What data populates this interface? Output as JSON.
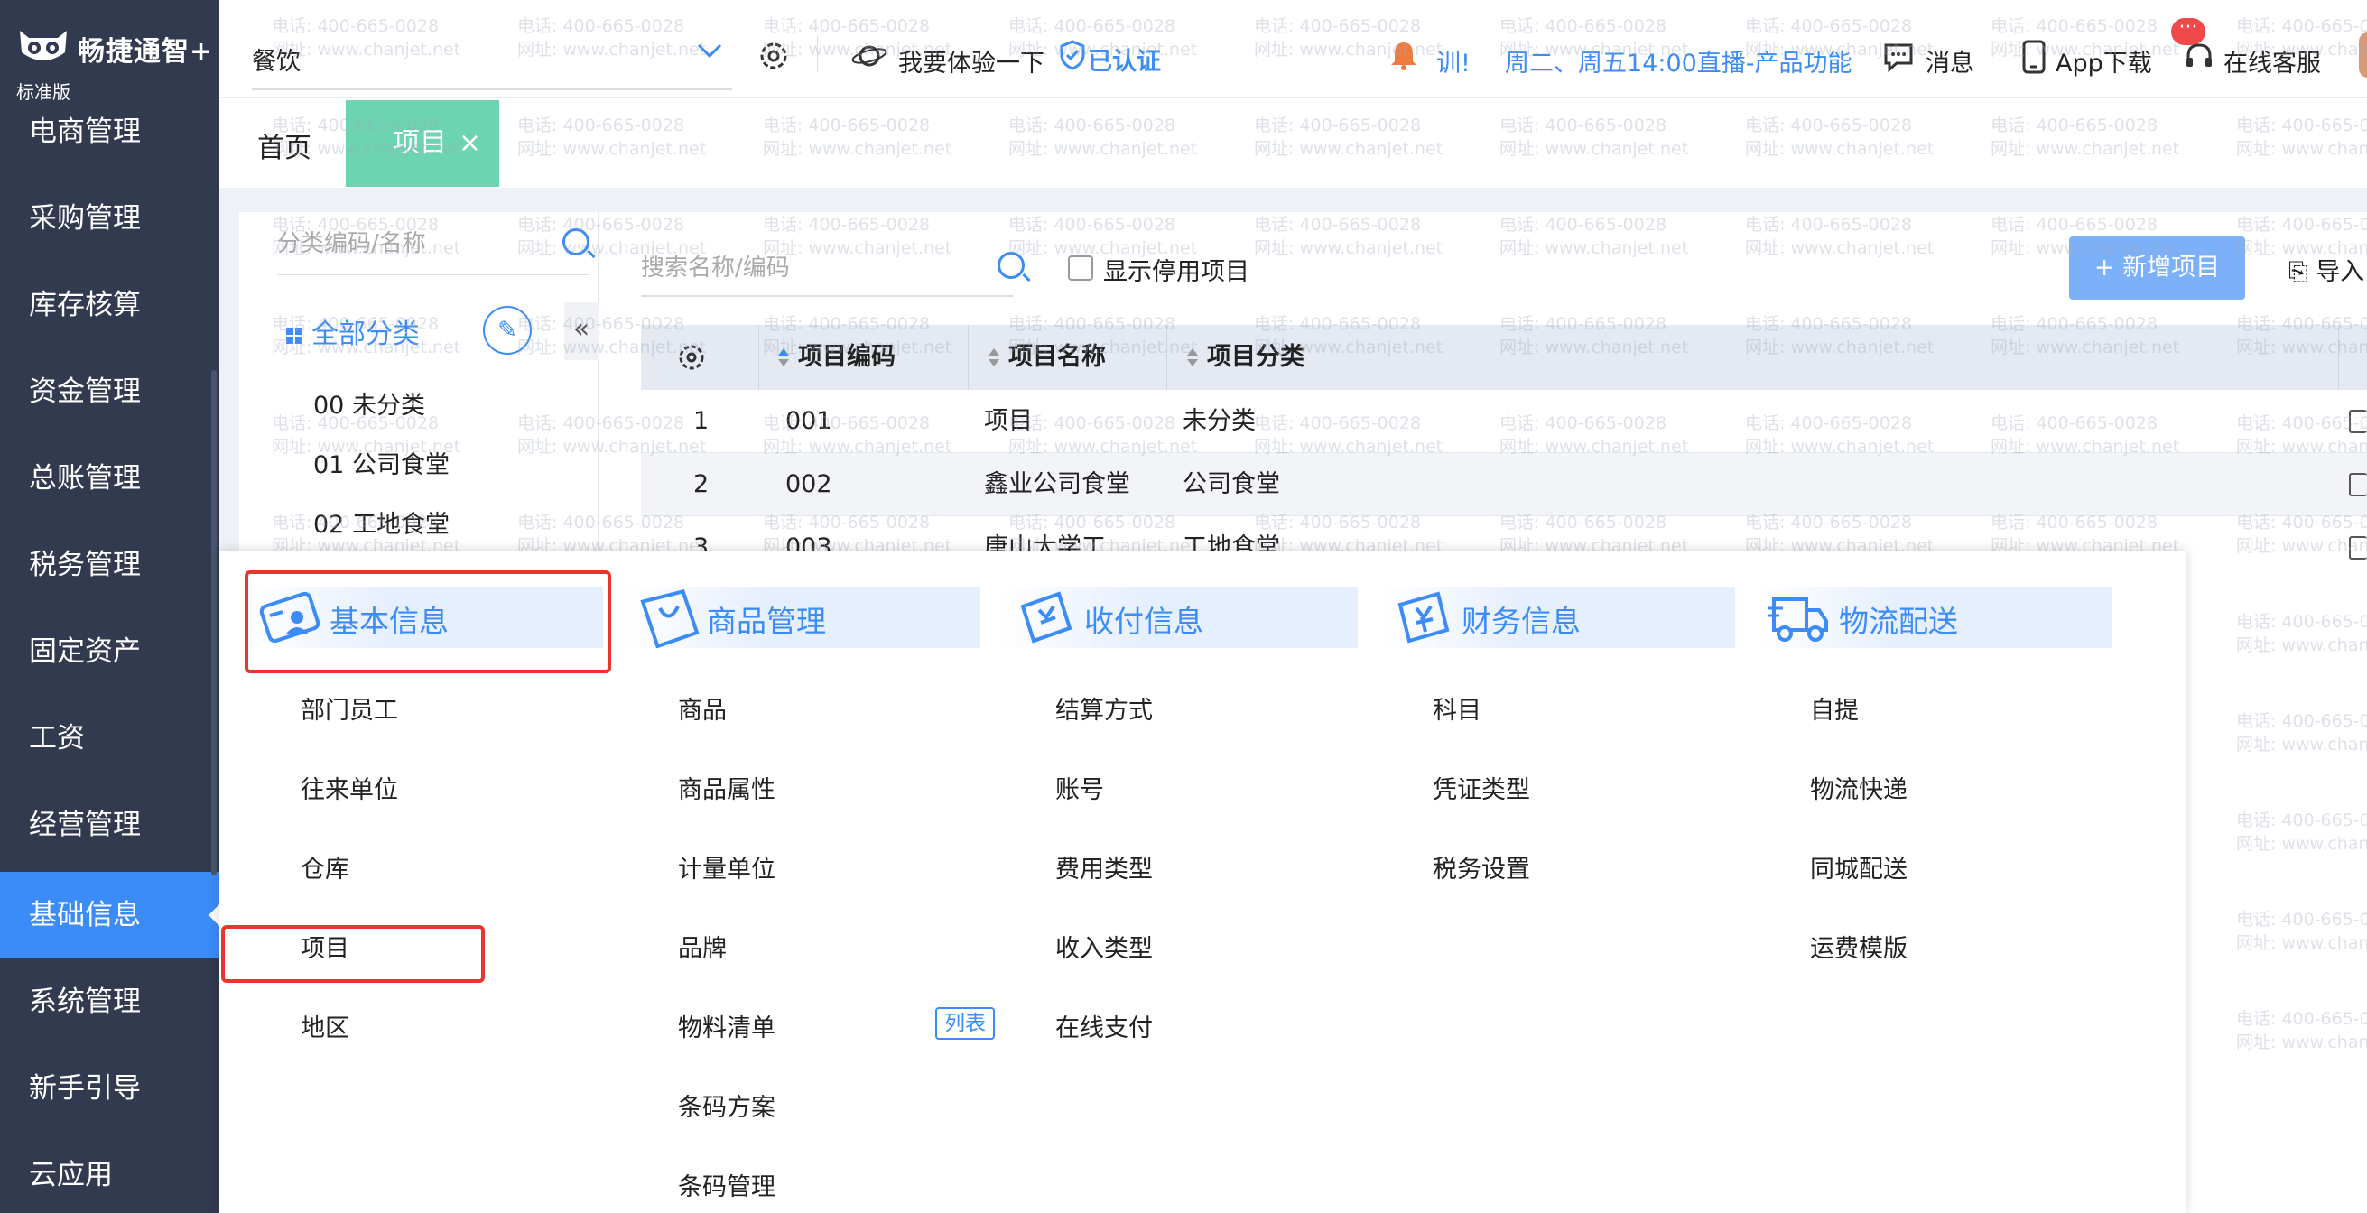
{
  "app": {
    "name": "畅捷通智+",
    "edition": "标准版"
  },
  "sidebar": {
    "items": [
      {
        "label": "电商管理"
      },
      {
        "label": "采购管理"
      },
      {
        "label": "库存核算"
      },
      {
        "label": "资金管理"
      },
      {
        "label": "总账管理"
      },
      {
        "label": "税务管理"
      },
      {
        "label": "固定资产"
      },
      {
        "label": "工资"
      },
      {
        "label": "经营管理"
      },
      {
        "label": "基础信息"
      },
      {
        "label": "系统管理"
      },
      {
        "label": "新手引导"
      },
      {
        "label": "云应用"
      }
    ],
    "active_index": 9
  },
  "topbar": {
    "industry": "餐饮",
    "experience": "我要体验一下",
    "verified": "已认证",
    "training": "训!",
    "live": "周二、周五14:00直播-产品功能",
    "messages": "消息",
    "message_badge": "···",
    "app_download": "App下载",
    "service": "在线客服"
  },
  "tabs": {
    "home": "首页",
    "active": "项目",
    "close": "×"
  },
  "category_panel": {
    "search_placeholder": "分类编码/名称",
    "all": "全部分类",
    "collapse": "«",
    "items": [
      "00 未分类",
      "01 公司食堂",
      "02 工地食堂"
    ]
  },
  "toolbar": {
    "search_placeholder": "搜索名称/编码",
    "show_disabled": "显示停用项目",
    "add": "+ 新增项目",
    "import": "导入"
  },
  "table": {
    "columns": [
      "项目编码",
      "项目名称",
      "项目分类"
    ],
    "rows": [
      {
        "no": "1",
        "code": "001",
        "name": "项目",
        "category": "未分类"
      },
      {
        "no": "2",
        "code": "002",
        "name": "鑫业公司食堂",
        "category": "公司食堂"
      },
      {
        "no": "3",
        "code": "003",
        "name": "唐山大学工",
        "category": "工地食堂"
      }
    ]
  },
  "watermark": {
    "line1": "电话: 400-665-0028",
    "line2": "网址: www.chanjet.net"
  },
  "menu": {
    "columns": [
      {
        "title": "基本信息",
        "icon": "id-card-icon",
        "items": [
          "部门员工",
          "往来单位",
          "仓库",
          "项目",
          "地区"
        ]
      },
      {
        "title": "商品管理",
        "icon": "shopping-bag-icon",
        "items": [
          "商品",
          "商品属性",
          "计量单位",
          "品牌",
          "物料清单",
          "条码方案",
          "条码管理"
        ]
      },
      {
        "title": "收付信息",
        "icon": "ticket-icon",
        "items": [
          "结算方式",
          "账号",
          "费用类型",
          "收入类型",
          "在线支付"
        ]
      },
      {
        "title": "财务信息",
        "icon": "finance-voucher-icon",
        "items": [
          "科目",
          "凭证类型",
          "税务设置"
        ]
      },
      {
        "title": "物流配送",
        "icon": "delivery-truck-icon",
        "items": [
          "自提",
          "物流快递",
          "同城配送",
          "运费模版"
        ]
      }
    ],
    "tag": "列表"
  },
  "colors": {
    "sidebar": "#323a50",
    "accent": "#3b8cf7",
    "tab": "#6cd4b0",
    "highlight": "#e8362d"
  }
}
